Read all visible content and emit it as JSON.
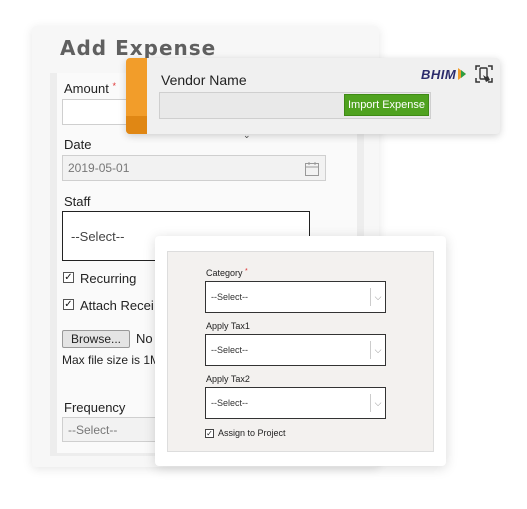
{
  "main": {
    "title": "Add Expense",
    "amount_label": "Amount",
    "required_mark": "*",
    "date_label": "Date",
    "date_value": "2019-05-01",
    "staff_label": "Staff",
    "staff_value": "--Select--",
    "recurring_label": "Recurring",
    "attach_label": "Attach Recei",
    "browse_label": "Browse...",
    "no_file_text": "No",
    "max_size_text": "Max file size is 1M",
    "frequency_label": "Frequency",
    "frequency_value": "--Select--"
  },
  "vendor": {
    "label": "Vendor Name",
    "import_button": "Import Expense",
    "bhim_logo_text": "BHIM",
    "scan_icon": "scan-phone-icon"
  },
  "category": {
    "category_label": "Category",
    "required_mark": "*",
    "category_value": "--Select--",
    "tax1_label": "Apply Tax1",
    "tax1_value": "--Select--",
    "tax2_label": "Apply Tax2",
    "tax2_value": "--Select--",
    "assign_label": "Assign to Project"
  },
  "colors": {
    "accent_orange": "#f29d2a",
    "import_green": "#4fa21f"
  }
}
